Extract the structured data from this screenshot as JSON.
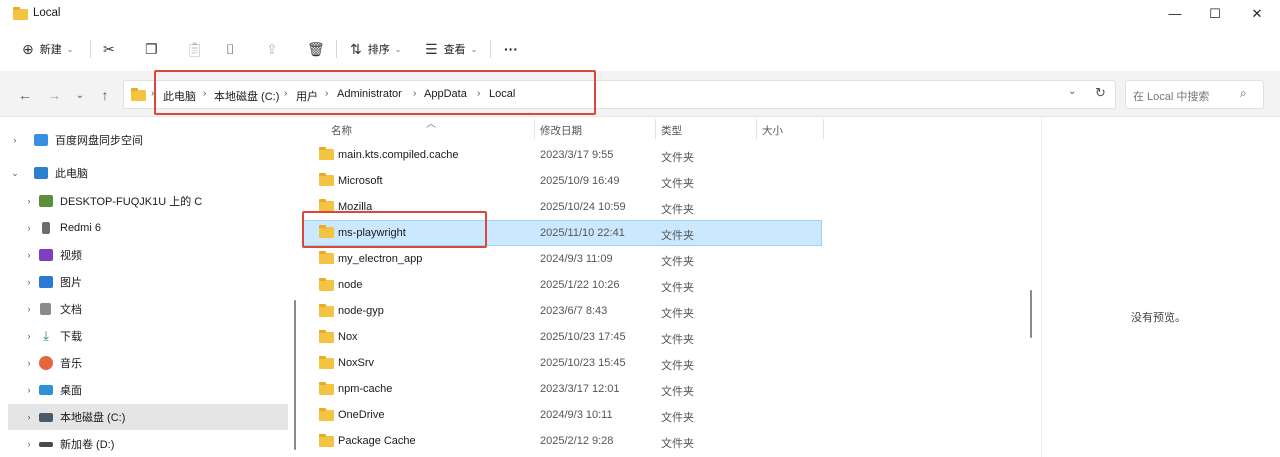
{
  "window": {
    "title": "Local",
    "minimize_glyph": "—",
    "maximize_glyph": "☐",
    "close_glyph": "✕"
  },
  "toolbar": {
    "new_label": "新建",
    "sort_label": "排序",
    "view_label": "查看",
    "more_glyph": "···",
    "icons": [
      "add-icon",
      "cut-icon",
      "copy-icon",
      "paste-icon",
      "rename-icon",
      "share-icon",
      "delete-icon",
      "sort-icon",
      "view-icon",
      "more-icon"
    ]
  },
  "address": {
    "crumbs": [
      "此电脑",
      "本地磁盘 (C:)",
      "用户",
      "Administrator",
      "AppData",
      "Local"
    ],
    "search_placeholder": "在 Local 中搜索"
  },
  "sidebar": {
    "items": [
      {
        "label": "百度网盘同步空间",
        "icon": "baidu-cloud-icon",
        "color": "#3a8ee6"
      },
      {
        "label": "此电脑",
        "icon": "pc-icon",
        "color": "#2b7fd0"
      },
      {
        "label": "DESKTOP-FUQJK1U 上的 C",
        "icon": "network-drive-icon",
        "color": "#5c8f3c"
      },
      {
        "label": "Redmi 6",
        "icon": "phone-icon",
        "color": "#6d6d6d"
      },
      {
        "label": "视频",
        "icon": "video-icon",
        "color": "#7b3fbf"
      },
      {
        "label": "图片",
        "icon": "pictures-icon",
        "color": "#2d7ad6"
      },
      {
        "label": "文档",
        "icon": "documents-icon",
        "color": "#8a8a8a"
      },
      {
        "label": "下载",
        "icon": "download-icon",
        "color": "#1b8a4b"
      },
      {
        "label": "音乐",
        "icon": "music-icon",
        "color": "#e2683c"
      },
      {
        "label": "桌面",
        "icon": "desktop-icon",
        "color": "#2f8fd8"
      },
      {
        "label": "本地磁盘 (C:)",
        "icon": "disk-icon",
        "color": "#4a5a6a"
      },
      {
        "label": "新加卷 (D:)",
        "icon": "disk-icon",
        "color": "#4a4a4a"
      }
    ]
  },
  "columns": {
    "name": "名称",
    "modified": "修改日期",
    "type": "类型",
    "size": "大小"
  },
  "files": [
    {
      "name": "main.kts.compiled.cache",
      "modified": "2023/3/17 9:55",
      "type": "文件夹"
    },
    {
      "name": "Microsoft",
      "modified": "2025/10/9 16:49",
      "type": "文件夹"
    },
    {
      "name": "Mozilla",
      "modified": "2025/10/24 10:59",
      "type": "文件夹"
    },
    {
      "name": "ms-playwright",
      "modified": "2025/11/10 22:41",
      "type": "文件夹"
    },
    {
      "name": "my_electron_app",
      "modified": "2024/9/3 11:09",
      "type": "文件夹"
    },
    {
      "name": "node",
      "modified": "2025/1/22 10:26",
      "type": "文件夹"
    },
    {
      "name": "node-gyp",
      "modified": "2023/6/7 8:43",
      "type": "文件夹"
    },
    {
      "name": "Nox",
      "modified": "2025/10/23 17:45",
      "type": "文件夹"
    },
    {
      "name": "NoxSrv",
      "modified": "2025/10/23 15:45",
      "type": "文件夹"
    },
    {
      "name": "npm-cache",
      "modified": "2023/3/17 12:01",
      "type": "文件夹"
    },
    {
      "name": "OneDrive",
      "modified": "2024/9/3 10:11",
      "type": "文件夹"
    },
    {
      "name": "Package Cache",
      "modified": "2025/2/12 9:28",
      "type": "文件夹"
    }
  ],
  "selected_file": "ms-playwright",
  "preview": {
    "empty_text": "没有预览。"
  },
  "colors": {
    "highlight_red": "#d9473d",
    "selection": "#cce8ff",
    "folder": "#f5c342"
  }
}
